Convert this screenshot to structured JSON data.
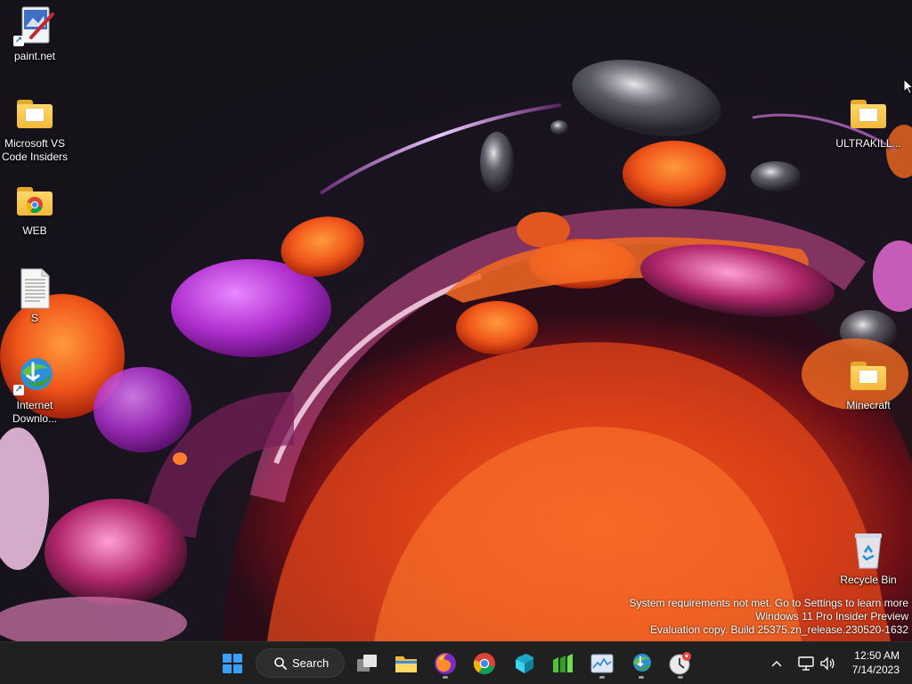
{
  "desktop": {
    "icons": [
      {
        "label": "paint.net"
      },
      {
        "label": "Microsoft VS Code Insiders"
      },
      {
        "label": "WEB"
      },
      {
        "label": "S"
      },
      {
        "label": "Internet Downlo..."
      },
      {
        "label": "ULTRAKILL..."
      },
      {
        "label": "Minecraft"
      },
      {
        "label": "Recycle Bin"
      }
    ]
  },
  "watermark": {
    "line1": "System requirements not met. Go to Settings to learn more",
    "line2": "Windows 11 Pro Insider Preview",
    "line3": "Evaluation copy. Build 25375.zn_release.230520-1632"
  },
  "taskbar": {
    "search_label": "Search",
    "apps": [
      {
        "name": "start-icon"
      },
      {
        "name": "task-view-icon"
      },
      {
        "name": "file-explorer-icon"
      },
      {
        "name": "firefox-icon"
      },
      {
        "name": "chrome-icon"
      },
      {
        "name": "app-icon-cube"
      },
      {
        "name": "app-icon-green-chart"
      },
      {
        "name": "task-manager-icon"
      },
      {
        "name": "internet-download-manager-icon"
      },
      {
        "name": "clock-app-icon"
      }
    ],
    "clock": {
      "time": "12:50 AM",
      "date": "7/14/2023"
    }
  },
  "colors": {
    "taskbar_bg": "#202020",
    "accent_blue": "#3aa0ff",
    "wallpaper_orange": "#f26a1b",
    "wallpaper_magenta": "#b22fd1"
  }
}
